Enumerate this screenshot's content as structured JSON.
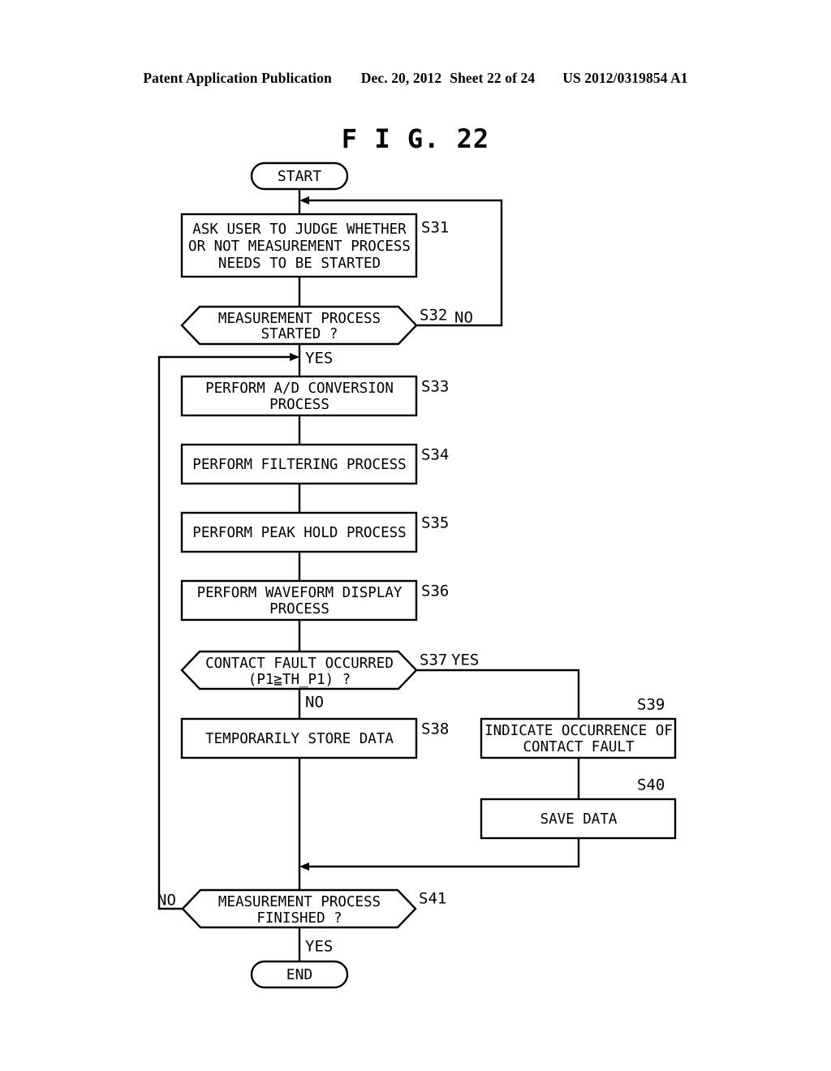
{
  "header": {
    "publication": "Patent Application Publication",
    "date": "Dec. 20, 2012",
    "sheet": "Sheet 22 of 24",
    "patent_number": "US 2012/0319854 A1"
  },
  "figure": {
    "title": "F I G. 22"
  },
  "flowchart": {
    "terminators": {
      "start": "START",
      "end": "END"
    },
    "steps": [
      {
        "id": "S31",
        "label": "S31",
        "type": "process",
        "lines": [
          "ASK USER TO JUDGE WHETHER",
          "OR NOT MEASUREMENT PROCESS",
          "NEEDS TO BE STARTED"
        ]
      },
      {
        "id": "S32",
        "label": "S32",
        "type": "decision",
        "lines": [
          "MEASUREMENT PROCESS",
          "STARTED ?"
        ],
        "yes": "YES",
        "no": "NO"
      },
      {
        "id": "S33",
        "label": "S33",
        "type": "process",
        "lines": [
          "PERFORM A/D CONVERSION",
          "PROCESS"
        ]
      },
      {
        "id": "S34",
        "label": "S34",
        "type": "process",
        "lines": [
          "PERFORM FILTERING PROCESS"
        ]
      },
      {
        "id": "S35",
        "label": "S35",
        "type": "process",
        "lines": [
          "PERFORM PEAK HOLD PROCESS"
        ]
      },
      {
        "id": "S36",
        "label": "S36",
        "type": "process",
        "lines": [
          "PERFORM WAVEFORM DISPLAY",
          "PROCESS"
        ]
      },
      {
        "id": "S37",
        "label": "S37",
        "type": "decision",
        "lines": [
          "CONTACT FAULT OCCURRED",
          "(P1≧TH_P1) ?"
        ],
        "yes": "YES",
        "no": "NO"
      },
      {
        "id": "S38",
        "label": "S38",
        "type": "process",
        "lines": [
          "TEMPORARILY STORE DATA"
        ]
      },
      {
        "id": "S39",
        "label": "S39",
        "type": "process",
        "lines": [
          "INDICATE OCCURRENCE OF",
          "CONTACT FAULT"
        ]
      },
      {
        "id": "S40",
        "label": "S40",
        "type": "process",
        "lines": [
          "SAVE DATA"
        ]
      },
      {
        "id": "S41",
        "label": "S41",
        "type": "decision",
        "lines": [
          "MEASUREMENT PROCESS",
          "FINISHED ?"
        ],
        "yes": "YES",
        "no": "NO"
      }
    ]
  },
  "colors": {
    "ink": "#000000",
    "paper": "#ffffff"
  }
}
